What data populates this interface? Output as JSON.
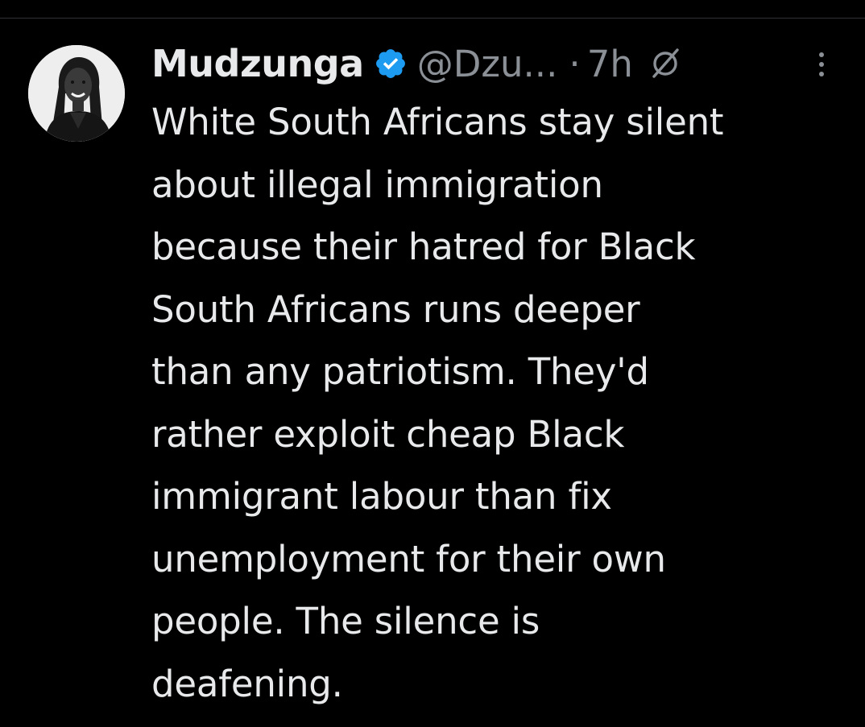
{
  "tweet": {
    "author_name": "Mudzunga",
    "author_handle": "@Dzu...",
    "separator": "·",
    "timestamp": "7h",
    "text": "White South Africans stay silent\nabout illegal immigration\nbecause their hatred for Black\nSouth Africans runs deeper\nthan any patriotism. They'd\nrather exploit cheap Black\nimmigrant labour than fix\nunemployment for their own\npeople. The silence is\ndeafening."
  },
  "icons": {
    "verified": "verified-badge-icon",
    "grok": "grok-icon",
    "more": "more-vertical-icon"
  },
  "colors": {
    "background": "#000000",
    "text": "#e7e9ea",
    "secondary_text": "#8b9096",
    "verified_blue": "#1d9bf0"
  }
}
